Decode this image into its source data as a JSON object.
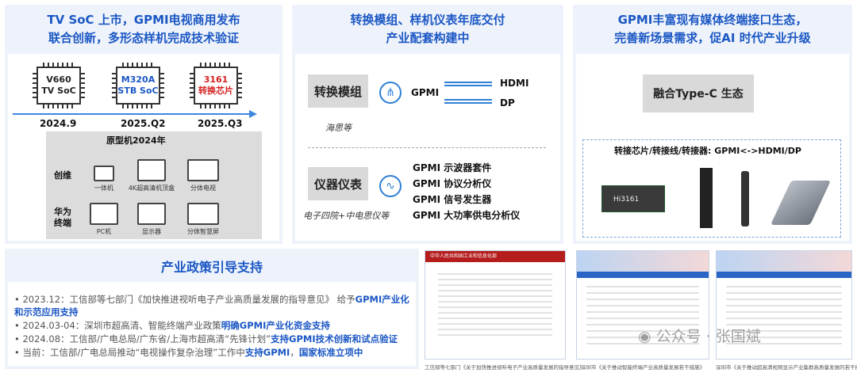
{
  "left_panel": {
    "title_line1": "TV SoC 上市，GPMI电视商用发布",
    "title_line2": "联合创新，多形态样机完成技术验证",
    "chips": [
      {
        "l1": "V660",
        "l2": "TV SoC"
      },
      {
        "l1": "M320A",
        "l2": "STB SoC"
      },
      {
        "l1": "3161",
        "l2": "转换芯片"
      }
    ],
    "dates": [
      "2024.9",
      "2025.Q2",
      "2025.Q3"
    ],
    "prototype_title": "原型机2024年",
    "vendor1": "创维",
    "vendor2_l1": "华为",
    "vendor2_l2": "终端",
    "devices": [
      "一体机",
      "4K超高清机顶盒",
      "分体电视",
      "PC机",
      "显示器",
      "分体智慧屏"
    ]
  },
  "mid_panel": {
    "title_line1": "转换模组、样机仪表年底交付",
    "title_line2": "产业配套构建中",
    "module_label": "转换模组",
    "module_sub": "海思等",
    "gpmi": "GPMI",
    "hdmi": "HDMI",
    "dp": "DP",
    "instrument_label": "仪器仪表",
    "instrument_sub": "电子四院+中电思仪等",
    "instruments": [
      "GPMI 示波器套件",
      "GPMI 协议分析仪",
      "GPMI 信号发生器",
      "GPMI 大功率供电分析仪"
    ]
  },
  "right_panel": {
    "title_line1": "GPMI丰富现有媒体终端接口生态，",
    "title_line2": "完善新场景需求，促AI 时代产业升级",
    "typec_label": "融合Type-C 生态",
    "products_title": "转接芯片/转接线/转接器: GPMI<->HDMI/DP",
    "chip_mark": "Hi3161"
  },
  "policy": {
    "title": "产业政策引导支持",
    "items": [
      {
        "pre": "2023.12：工信部等七部门《加快推进视听电子产业高质量发展的指导意见》 给予",
        "hl": "GPMI产业化和示范应用支持",
        "post": ""
      },
      {
        "pre": "2024.03-04：深圳市超高清、智能终端产业政策",
        "hl": "明确GPMI产业化资金支持",
        "post": ""
      },
      {
        "pre": "2024.08：工信部/广电总局/广东省/上海市超高清“先锋计划”",
        "hl": "支持GPMI技术创新和试点验证",
        "post": ""
      },
      {
        "pre": "当前：工信部/广电总局推动“电视操作复杂治理”工作中",
        "hl": "支持GPMI",
        "post": "，",
        "hl2": "国家标准立项中"
      }
    ]
  },
  "docs": {
    "captions": [
      "工信部等七部门《关于加快推进视听电子产业高质量发展的指导意见》",
      "深圳市《关于推动智能终端产业高质量发展若干措施》",
      "深圳市《关于推动超高清视频显示产业集群高质量发展的若干措施》"
    ],
    "doc1_header": "中华人民共和国工业和信息化部"
  },
  "watermark": "公众号 · 张国斌"
}
